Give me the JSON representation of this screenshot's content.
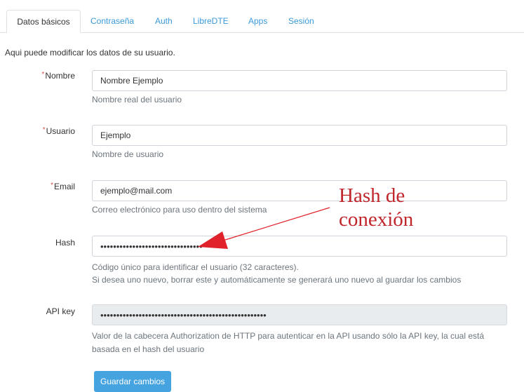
{
  "tabs": [
    {
      "label": "Datos básicos",
      "active": true
    },
    {
      "label": "Contraseña",
      "active": false
    },
    {
      "label": "Auth",
      "active": false
    },
    {
      "label": "LibreDTE",
      "active": false
    },
    {
      "label": "Apps",
      "active": false
    },
    {
      "label": "Sesión",
      "active": false
    }
  ],
  "intro": "Aqui puede modificar los datos de su usuario.",
  "form": {
    "required_mark": "*",
    "nombre": {
      "label": "Nombre",
      "value": "Nombre Ejemplo",
      "help": "Nombre real del usuario"
    },
    "usuario": {
      "label": "Usuario",
      "value": "Ejemplo",
      "help": "Nombre de usuario"
    },
    "email": {
      "label": "Email",
      "value": "ejemplo@mail.com",
      "help": "Correo electrónico para uso dentro del sistema"
    },
    "hash": {
      "label": "Hash",
      "value": "••••••••••••••••••••••••••••••••",
      "help_line1": "Código único para identificar el usuario (32 caracteres).",
      "help_line2": "Si desea uno nuevo, borrar este y automáticamente se generará uno nuevo al guardar los cambios"
    },
    "api_key": {
      "label": "API key",
      "value": "••••••••••••••••••••••••••••••••••••••••••••••••••••",
      "help": "Valor de la cabecera Authorization de HTTP para autenticar en la API usando sólo la API key, la cual está basada en el hash del usuario"
    },
    "save_label": "Guardar cambios"
  },
  "annotation": {
    "line1": "Hash de",
    "line2": "conexión",
    "color": "#c0262b"
  },
  "colors": {
    "accent": "#3a9ad9",
    "button": "#45a3e0",
    "required": "#d9534f"
  }
}
